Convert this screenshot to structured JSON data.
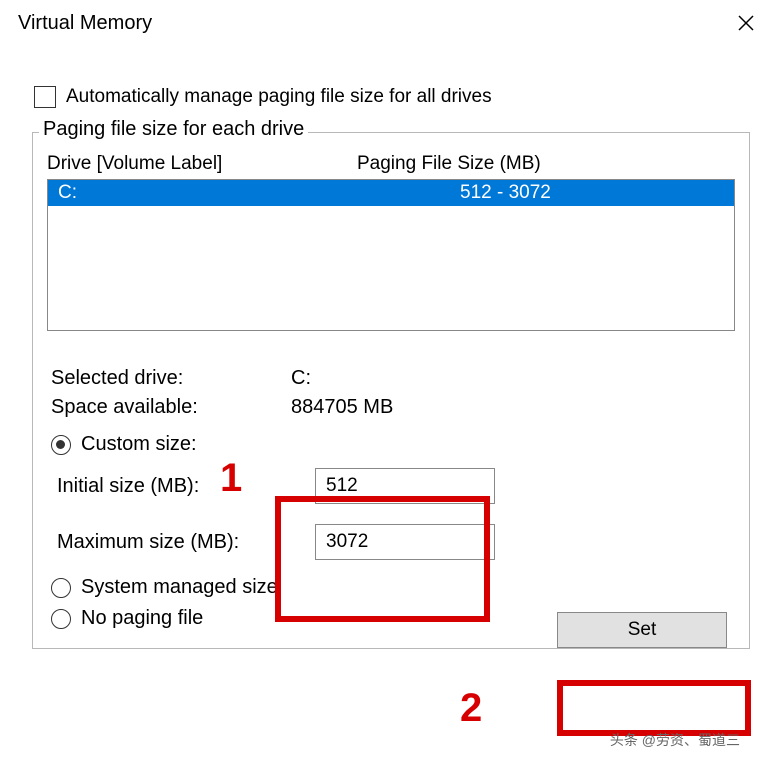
{
  "title": "Virtual Memory",
  "auto_manage_label": "Automatically manage paging file size for all drives",
  "group_legend": "Paging file size for each drive",
  "list": {
    "header_drive": "Drive  [Volume Label]",
    "header_size": "Paging File Size (MB)",
    "rows": [
      {
        "drive": "C:",
        "size": "512 - 3072"
      }
    ]
  },
  "info": {
    "selected_label": "Selected drive:",
    "selected_value": "C:",
    "space_label": "Space available:",
    "space_value": "884705 MB"
  },
  "radios": {
    "custom_label": "Custom size:",
    "initial_label": "Initial size (MB):",
    "initial_value": "512",
    "max_label": "Maximum size (MB):",
    "max_value": "3072",
    "system_label": "System managed size",
    "nopaging_label": "No paging file"
  },
  "set_button": "Set",
  "annotations": {
    "num1": "1",
    "num2": "2"
  },
  "watermark": "头条 @劳资、蜀道三"
}
